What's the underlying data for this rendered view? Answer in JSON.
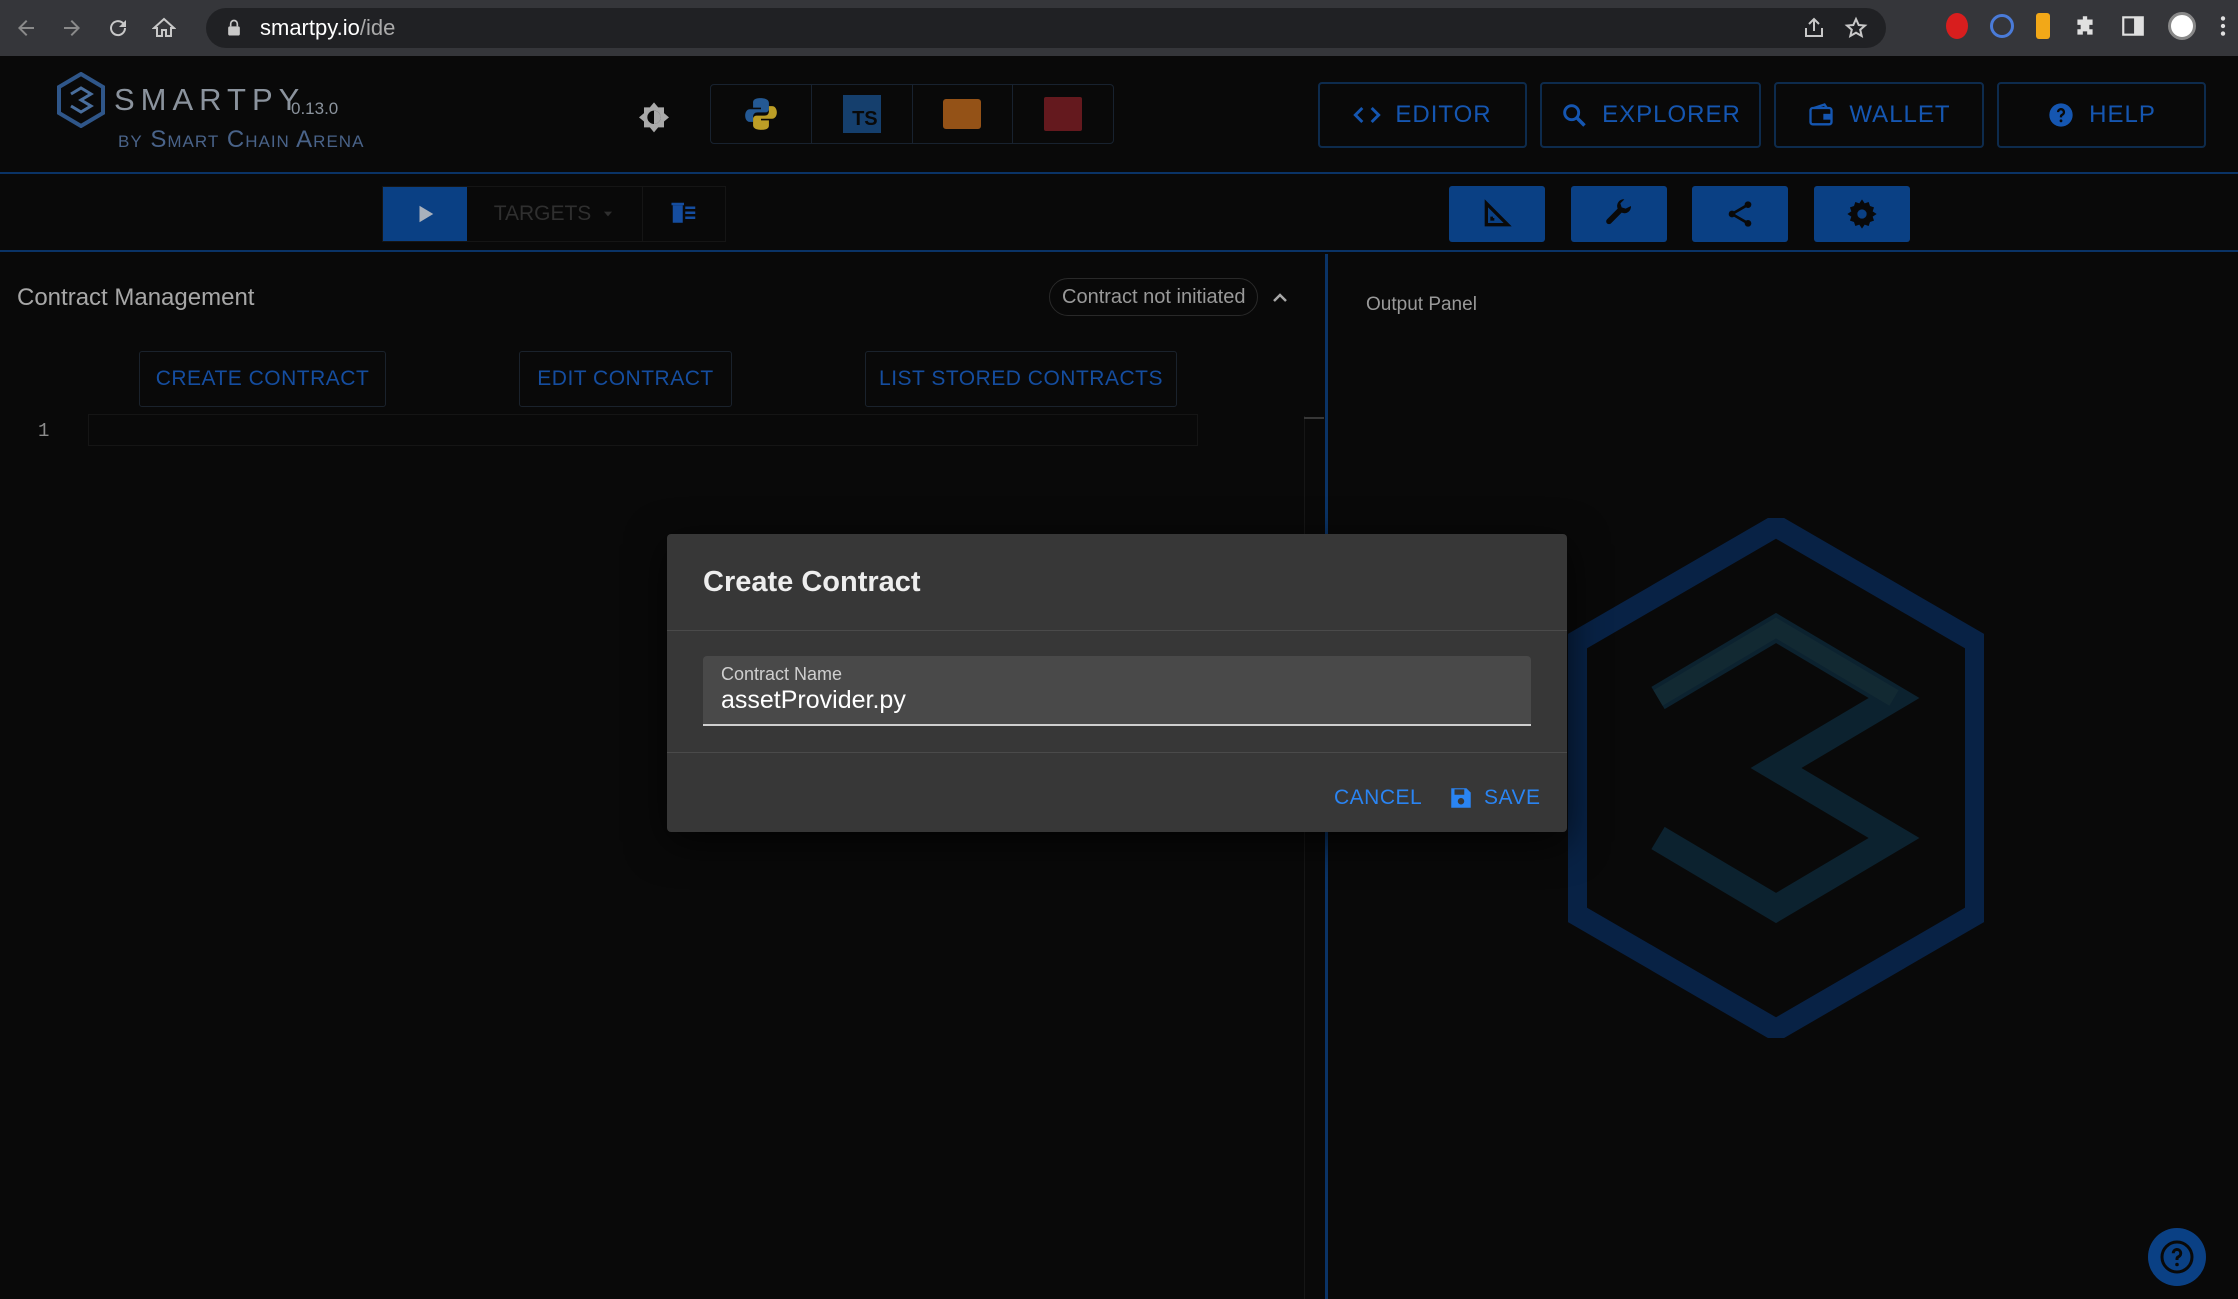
{
  "browser": {
    "url_host": "smartpy.io",
    "url_path": "/ide"
  },
  "header": {
    "brand": "SMARTPY",
    "version": "0.13.0",
    "byline": "by Smart Chain Arena",
    "nav": [
      {
        "label": "EDITOR",
        "icon": "code-icon"
      },
      {
        "label": "EXPLORER",
        "icon": "search-icon"
      },
      {
        "label": "WALLET",
        "icon": "wallet-icon"
      },
      {
        "label": "HELP",
        "icon": "help-icon"
      }
    ],
    "languages": [
      "python",
      "typescript",
      "ocaml",
      "michelson"
    ]
  },
  "toolbar": {
    "targets_label": "TARGETS",
    "tools": [
      "ruler-icon",
      "wrench-icon",
      "share-icon",
      "gear-icon"
    ]
  },
  "editor": {
    "title": "Contract Management",
    "status_chip": "Contract not initiated",
    "buttons": {
      "create": "CREATE CONTRACT",
      "edit": "EDIT CONTRACT",
      "list": "LIST STORED CONTRACTS"
    },
    "line_number": "1"
  },
  "output": {
    "title": "Output Panel"
  },
  "dialog": {
    "title": "Create Contract",
    "field_label": "Contract Name",
    "field_value": "assetProvider.py",
    "cancel": "CANCEL",
    "save": "SAVE"
  },
  "colors": {
    "accent": "#0d4fa2",
    "link": "#2a84f2",
    "dialog_bg": "#373737"
  }
}
